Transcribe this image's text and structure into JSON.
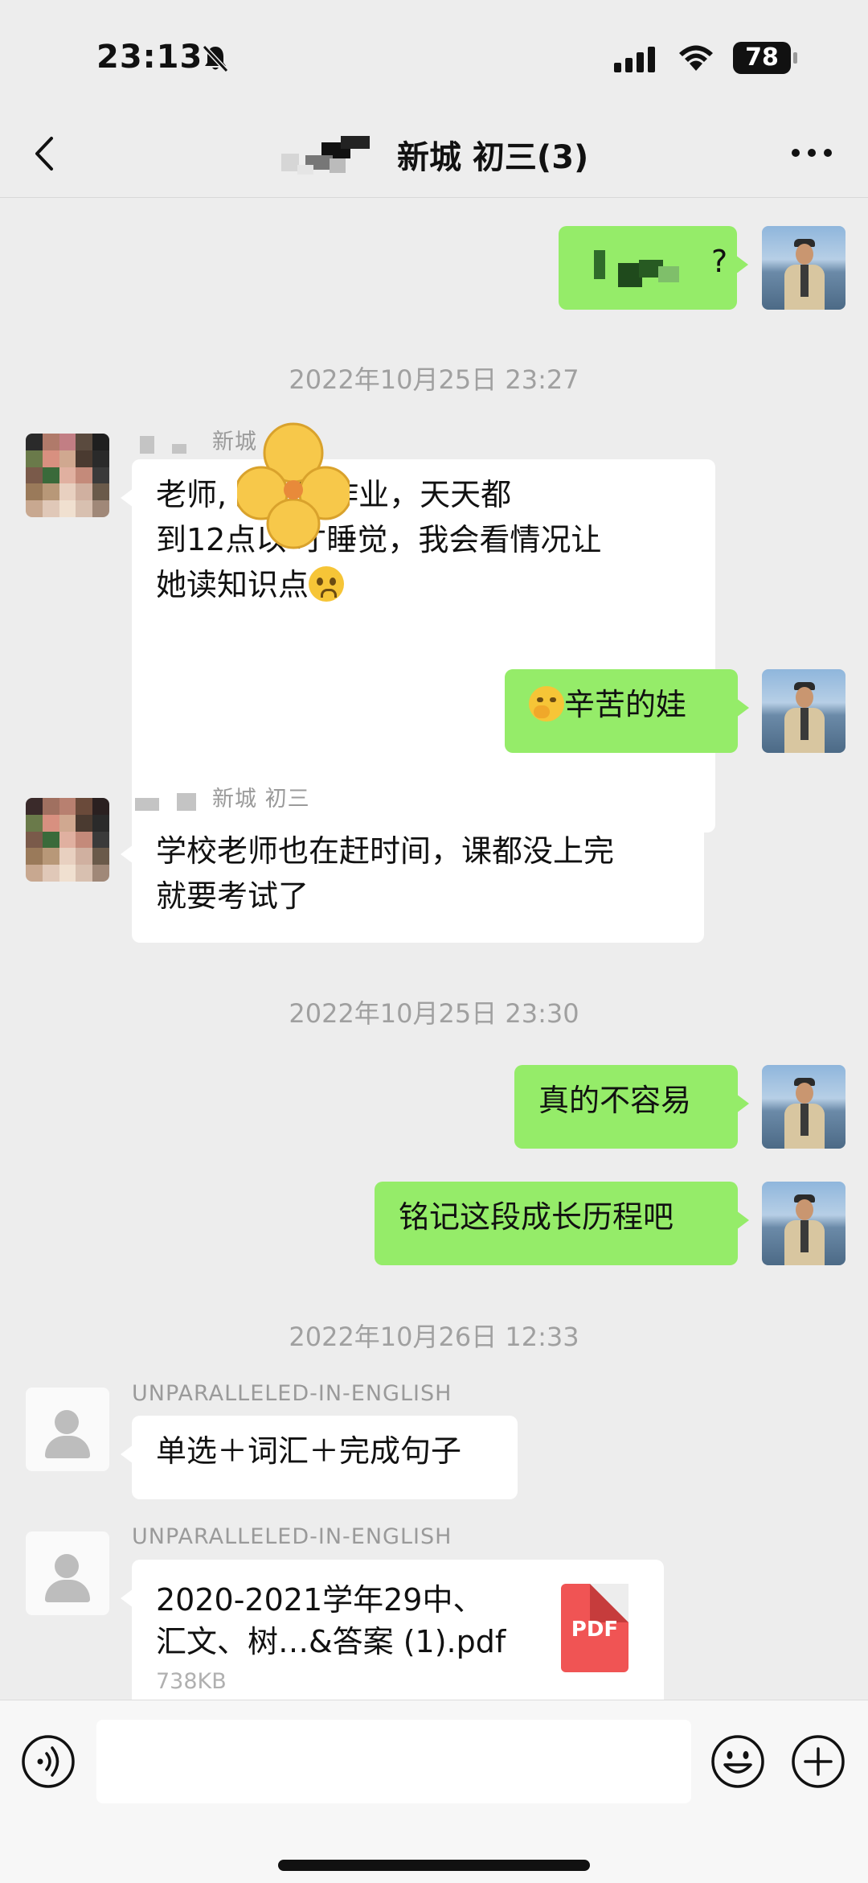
{
  "status_bar": {
    "time": "23:13",
    "battery": "78"
  },
  "nav": {
    "title": "新城   初三(3)"
  },
  "messages": {
    "out_1": "?",
    "time_1": "2022年10月25日 23:27",
    "in_1_sender": "新城",
    "in_1_lines": [
      "老师,        还在写作业，天天都",
      "到12点以   才睡觉，我会看情况让",
      "她读知识点"
    ],
    "out_2": "辛苦的娃",
    "in_2_sender": "新城  初三",
    "in_2_lines": [
      "学校老师也在赶时间，课都没上完",
      "就要考试了"
    ],
    "time_2": "2022年10月25日 23:30",
    "out_3": "真的不容易",
    "out_4": "铭记这段成长历程吧",
    "time_3": "2022年10月26日 12:33",
    "in_3_sender": "UNPARALLELED-IN-ENGLISH",
    "in_3": "单选＋词汇＋完成句子",
    "in_4_sender": "UNPARALLELED-IN-ENGLISH",
    "file": {
      "name_line1": "2020-2021学年29中、",
      "name_line2": "汇文、树…&答案 (1).pdf",
      "size": "738KB",
      "icon_label": "PDF"
    }
  },
  "input": {
    "placeholder": ""
  }
}
